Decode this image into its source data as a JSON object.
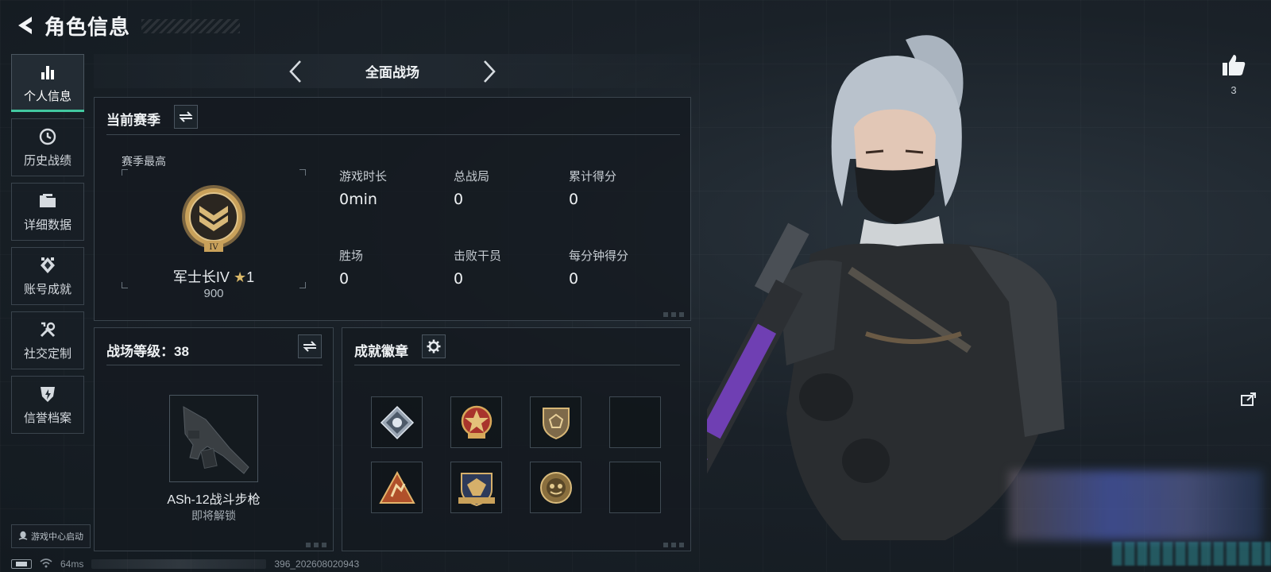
{
  "header": {
    "title": "角色信息"
  },
  "sidebar": {
    "items": [
      {
        "label": "个人信息",
        "icon": "bar-chart-icon",
        "active": true
      },
      {
        "label": "历史战绩",
        "icon": "clock-history-icon"
      },
      {
        "label": "详细数据",
        "icon": "folder-icon"
      },
      {
        "label": "账号成就",
        "icon": "achievement-icon"
      },
      {
        "label": "社交定制",
        "icon": "tools-icon"
      },
      {
        "label": "信誉档案",
        "icon": "shield-bolt-icon"
      }
    ],
    "launch_label": "游戏中心启动"
  },
  "mode": {
    "title": "全面战场"
  },
  "season": {
    "title": "当前赛季",
    "best_label": "赛季最高",
    "rank_name": "军士长IV",
    "rank_stars": "1",
    "rank_points": "900",
    "stats": [
      {
        "label": "游戏时长",
        "value": "0min"
      },
      {
        "label": "总战局",
        "value": "0"
      },
      {
        "label": "累计得分",
        "value": "0"
      },
      {
        "label": "胜场",
        "value": "0"
      },
      {
        "label": "击败干员",
        "value": "0"
      },
      {
        "label": "每分钟得分",
        "value": "0"
      }
    ]
  },
  "level": {
    "title": "战场等级：38",
    "weapon_name": "ASh-12战斗步枪",
    "weapon_status": "即将解锁"
  },
  "badges": {
    "title": "成就徽章",
    "slots": [
      "diamond-badge-icon",
      "star-medal-badge-icon",
      "shield-badge-icon",
      "empty-slot",
      "triangle-badge-icon",
      "eagle-crest-badge-icon",
      "round-emblem-badge-icon",
      "empty-slot"
    ]
  },
  "social": {
    "like_count": "3"
  },
  "status": {
    "ping": "64ms",
    "uid_suffix": "396_202608020943"
  },
  "colors": {
    "accent": "#42c8a0",
    "gold": "#c9a15a",
    "panel_border": "#3a444d"
  }
}
